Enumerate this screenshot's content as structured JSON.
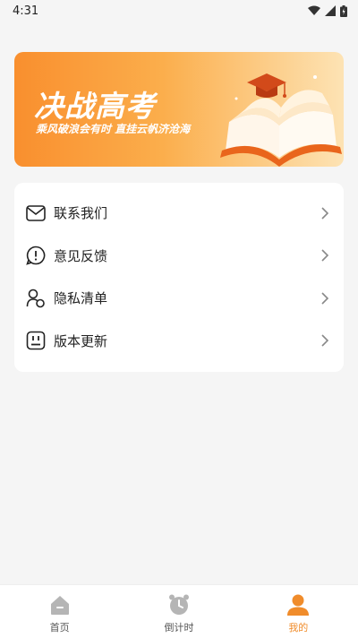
{
  "status_bar": {
    "time": "4:31"
  },
  "banner": {
    "title": "决战高考",
    "subtitle": "乘风破浪会有时  直挂云帆济沧海"
  },
  "menu": {
    "items": [
      {
        "label": "联系我们",
        "icon": "mail-icon"
      },
      {
        "label": "意见反馈",
        "icon": "feedback-icon"
      },
      {
        "label": "隐私清单",
        "icon": "privacy-user-icon"
      },
      {
        "label": "版本更新",
        "icon": "version-update-icon"
      }
    ]
  },
  "tab_bar": {
    "tabs": [
      {
        "label": "首页",
        "icon": "home-icon",
        "active": false
      },
      {
        "label": "倒计时",
        "icon": "alarm-clock-icon",
        "active": false
      },
      {
        "label": "我的",
        "icon": "profile-icon",
        "active": true
      }
    ]
  },
  "colors": {
    "accent": "#f08c2b",
    "banner_start": "#f98f2e",
    "banner_end": "#fde3b4",
    "background": "#f5f5f5",
    "inactive_icon": "#b5b5b5"
  }
}
